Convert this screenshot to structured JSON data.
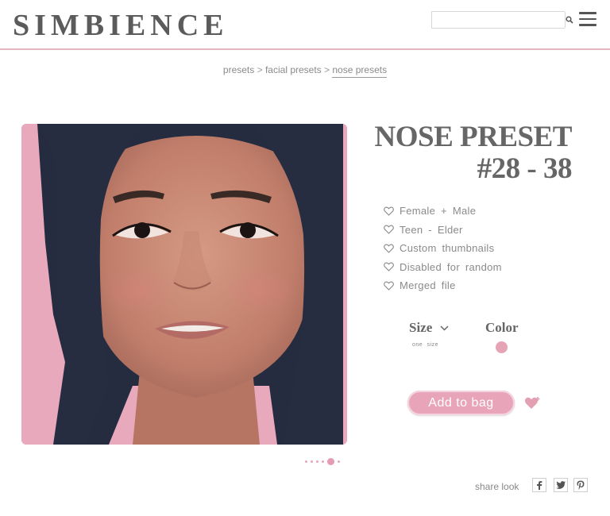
{
  "header": {
    "logo": "SIMBIENCE",
    "search": {
      "placeholder": "",
      "value": ""
    }
  },
  "breadcrumb": {
    "items": [
      "presets",
      "facial presets",
      "nose presets"
    ],
    "separator": ">"
  },
  "product": {
    "title_line1": "NOSE PRESET",
    "title_line2": "#28 - 38",
    "features": [
      "Female + Male",
      "Teen - Elder",
      "Custom thumbnails",
      "Disabled for random",
      "Merged file"
    ],
    "size_label": "Size",
    "size_value": "one size",
    "color_label": "Color",
    "color_swatch": "#e5a3b6",
    "add_to_bag": "Add to bag"
  },
  "carousel": {
    "count": 6,
    "active_index": 4
  },
  "share": {
    "label": "share look"
  },
  "colors": {
    "accent": "#e8a4b8",
    "header_line": "#e3b7c2",
    "image_background": "#e9a9bd",
    "hair": "#252c3f"
  }
}
